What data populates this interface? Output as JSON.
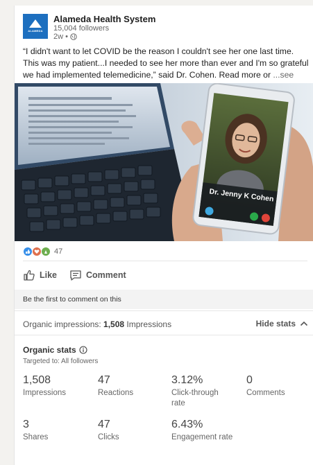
{
  "org": {
    "name": "Alameda Health System",
    "followers": "15,004 followers",
    "time": "2w •",
    "logo_text": "ALAMEDA"
  },
  "post": {
    "text": "“I didn't want to let COVID be the reason I couldn't see her one last time. This was my patient...I needed to see her more than ever and I'm so grateful we had implemented telemedicine,” said Dr. Cohen. Read more or ",
    "see_more": "...see more",
    "image_caption": "Dr. Jenny K Cohen"
  },
  "reactions": {
    "count": "47",
    "icons": [
      "like-icon",
      "love-icon",
      "celebrate-icon"
    ]
  },
  "actions": {
    "like_label": "Like",
    "comment_label": "Comment"
  },
  "comments": {
    "empty_text": "Be the first to comment on this"
  },
  "impressions": {
    "label": "Organic impressions: ",
    "value": "1,508",
    "unit": " Impressions",
    "hide_label": "Hide stats"
  },
  "stats": {
    "title": "Organic stats",
    "targeted": "Targeted to: All followers",
    "items": [
      {
        "value": "1,508",
        "label": "Impressions"
      },
      {
        "value": "47",
        "label": "Reactions"
      },
      {
        "value": "3.12%",
        "label": "Click-through rate"
      },
      {
        "value": "0",
        "label": "Comments"
      },
      {
        "value": "3",
        "label": "Shares"
      },
      {
        "value": "47",
        "label": "Clicks"
      },
      {
        "value": "6.43%",
        "label": "Engagement rate"
      }
    ]
  },
  "colors": {
    "like": "#378fe9",
    "love": "#df704d",
    "celebrate": "#6dae4f",
    "brand": "#1d6fbf"
  }
}
